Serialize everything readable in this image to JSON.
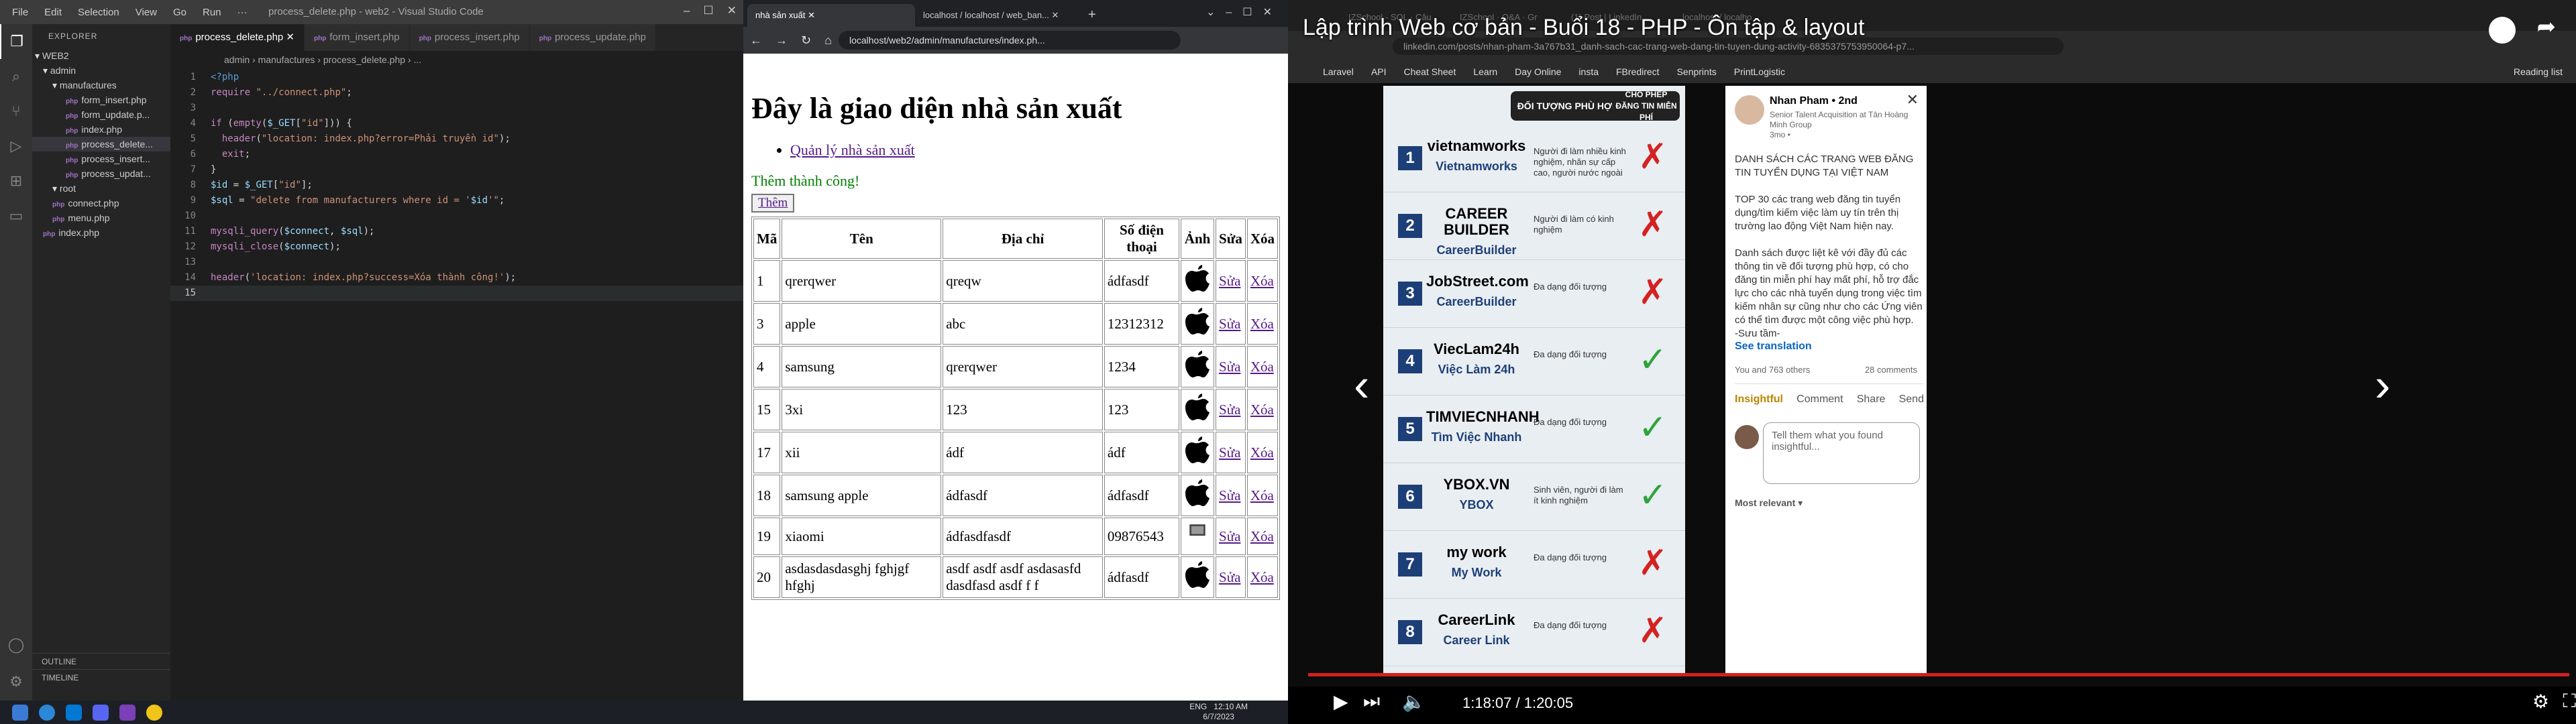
{
  "vscode": {
    "menu": [
      "File",
      "Edit",
      "Selection",
      "View",
      "Go",
      "Run",
      "···"
    ],
    "window_title": "process_delete.php - web2 - Visual Studio Code",
    "explorer_label": "EXPLORER",
    "tree": [
      {
        "label": "WEB2",
        "kind": "root"
      },
      {
        "label": "admin",
        "kind": "folder"
      },
      {
        "label": "manufactures",
        "kind": "folder"
      },
      {
        "label": "form_insert.php",
        "kind": "file"
      },
      {
        "label": "form_update.p...",
        "kind": "file"
      },
      {
        "label": "index.php",
        "kind": "file"
      },
      {
        "label": "process_delete...",
        "kind": "file",
        "selected": true
      },
      {
        "label": "process_insert...",
        "kind": "file"
      },
      {
        "label": "process_updat...",
        "kind": "file"
      },
      {
        "label": "root",
        "kind": "folder"
      },
      {
        "label": "connect.php",
        "kind": "file"
      },
      {
        "label": "menu.php",
        "kind": "file"
      },
      {
        "label": "index.php",
        "kind": "file"
      }
    ],
    "outline_label": "OUTLINE",
    "timeline_label": "TIMELINE",
    "tabs": [
      "process_delete.php",
      "form_insert.php",
      "process_insert.php",
      "process_update.php"
    ],
    "breadcrumb": "admin › manufactures › process_delete.php › ...",
    "code": [
      "<?php",
      "require \"../connect.php\";",
      "",
      "if (empty($_GET[\"id\"])) {",
      "  header(\"location: index.php?error=Phải truyền id\");",
      "  exit;",
      "}",
      "$id = $_GET[\"id\"];",
      "$sql = \"delete from manufacturers where id = '$id'\";",
      "",
      "mysqli_query($connect, $sql);",
      "mysqli_close($connect);",
      "",
      "header('location: index.php?success=Xóa thành công!');",
      ""
    ]
  },
  "browser": {
    "tabs": [
      "nhà sản xuất",
      "localhost / localhost / web_ban..."
    ],
    "url": "localhost/web2/admin/manufactures/index.ph...",
    "heading": "Đây là giao diện nhà sản xuất",
    "nav_link": "Quản lý nhà sản xuất",
    "success_msg": "Thêm thành công!",
    "add_button": "Thêm",
    "columns": [
      "Mã",
      "Tên",
      "Địa chỉ",
      "Số điện thoại",
      "Ảnh",
      "Sửa",
      "Xóa"
    ],
    "rows": [
      {
        "id": "1",
        "name": "qrerqwer",
        "addr": "qreqw",
        "phone": "ádfasdf"
      },
      {
        "id": "3",
        "name": "apple",
        "addr": "abc",
        "phone": "12312312"
      },
      {
        "id": "4",
        "name": "samsung",
        "addr": "qrerqwer",
        "phone": "1234"
      },
      {
        "id": "15",
        "name": "3xi",
        "addr": "123",
        "phone": "123"
      },
      {
        "id": "17",
        "name": "xii",
        "addr": "ádf",
        "phone": "ádf"
      },
      {
        "id": "18",
        "name": "samsung apple",
        "addr": "ádfasdf",
        "phone": "ádfasdf"
      },
      {
        "id": "19",
        "name": "xiaomi",
        "addr": "ádfasdfasdf",
        "phone": "09876543"
      },
      {
        "id": "20",
        "name": "asdasdasdasghj fghjgf hfghj",
        "addr": "asdf asdf asdf asdasasfd dasdfasd asdf f f",
        "phone": "ádfasdf"
      }
    ],
    "edit_label": "Sửa",
    "delete_label": "Xóa"
  },
  "video": {
    "title": "Lập trình Web cơ bản - Buổi 18 - PHP - Ôn tập & layout",
    "linkedin_url": "linkedin.com/posts/nhan-pham-3a767b31_danh-sach-cac-trang-web-dang-tin-tuyen-dung-activity-6835375753950064-p7...",
    "bookmarks": [
      "Laravel",
      "API",
      "Cheat Sheet",
      "Learn",
      "Day Online",
      "insta",
      "FBredirect",
      "Senprints",
      "PrintLogistic",
      "Reading list"
    ],
    "infographic": {
      "header_left": "ĐỐI TƯỢNG PHÙ HỢP",
      "header_right": "CHO PHÉP ĐĂNG TIN MIỄN PHÍ",
      "rows": [
        {
          "n": "1",
          "logo": "vietnamworks",
          "sub": "Vietnamworks",
          "desc": "Người đi làm nhiều kinh nghiệm, nhân sự cấp cao, người nước ngoài",
          "ok": false
        },
        {
          "n": "2",
          "logo": "CAREER BUILDER",
          "sub": "CareerBuilder",
          "desc": "Người đi làm có kinh nghiệm",
          "ok": false
        },
        {
          "n": "3",
          "logo": "JobStreet.com",
          "sub": "CareerBuilder",
          "desc": "Đa dạng đối tượng",
          "ok": false
        },
        {
          "n": "4",
          "logo": "ViecLam24h",
          "sub": "Việc Làm 24h",
          "desc": "Đa dạng đối tượng",
          "ok": true
        },
        {
          "n": "5",
          "logo": "TIMVIECNHANH",
          "sub": "Tìm Việc Nhanh",
          "desc": "Đa dạng đối tượng",
          "ok": true
        },
        {
          "n": "6",
          "logo": "YBOX.VN",
          "sub": "YBOX",
          "desc": "Sinh viên, người đi làm ít kinh nghiệm",
          "ok": true
        },
        {
          "n": "7",
          "logo": "my work",
          "sub": "My Work",
          "desc": "Đa dạng đối tượng",
          "ok": false
        },
        {
          "n": "8",
          "logo": "CareerLink",
          "sub": "Career Link",
          "desc": "Đa dạng đối tượng",
          "ok": false
        }
      ]
    },
    "post": {
      "author": "Nhan Pham • 2nd",
      "headline": "Senior Talent Acquisition at Tân Hoàng Minh Group",
      "time": "3mo •",
      "p1": "DANH SÁCH CÁC TRANG WEB ĐĂNG TIN TUYỂN DỤNG TẠI VIỆT NAM",
      "p2": "TOP 30 các trang web đăng tin tuyển dụng/tìm kiếm việc làm uy tín trên thị trường lao động Việt Nam hiện nay.",
      "p3": "Danh sách được liệt kê với đầy đủ các thông tin về đối tượng phù hợp, có cho đăng tin miễn phí hay mất phí, hỗ trợ đắc lực cho các nhà tuyển dụng trong việc tìm kiếm nhân sự cũng như cho các Ứng viên có thể tìm được một công việc phù hợp.",
      "p4": "-Sưu tầm-",
      "see_translation": "See translation",
      "reactions": "You and 763 others",
      "comments": "28 comments",
      "actions": [
        "Insightful",
        "Comment",
        "Share",
        "Send"
      ],
      "comment_placeholder": "Tell them what you found insightful...",
      "sort": "Most relevant ▾"
    },
    "time": "1:18:07 / 1:20:05"
  },
  "taskbar": {
    "lang": "ENG",
    "time": "12:10 AM",
    "date": "6/7/2023"
  }
}
